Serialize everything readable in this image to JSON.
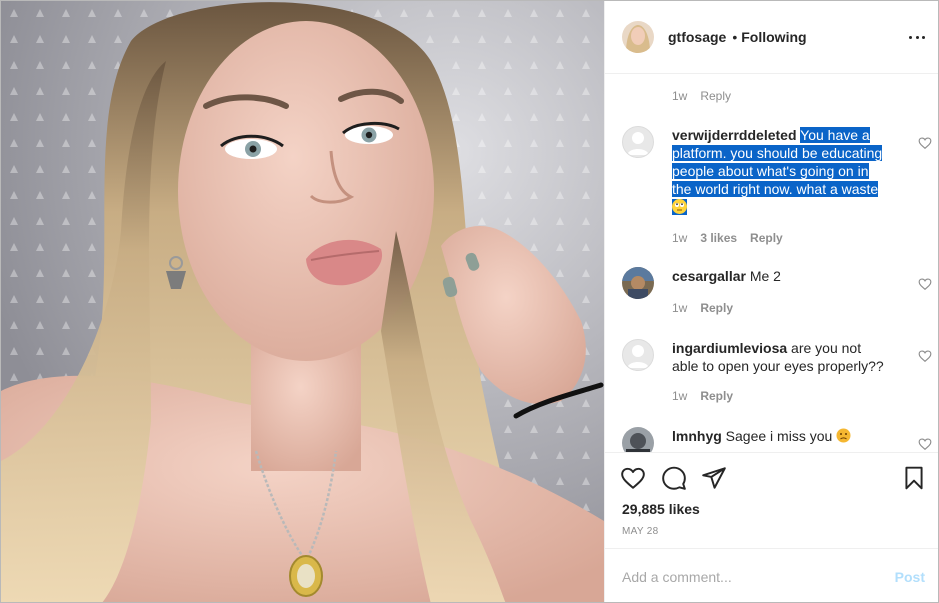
{
  "post": {
    "username": "gtfosage",
    "dot": "•",
    "follow_status": "Following",
    "likes": "29,885 likes",
    "date": "MAY 28"
  },
  "comments": [
    {
      "meta_time": "1w",
      "meta_reply": "Reply"
    },
    {
      "username": "verwijderrddeleted",
      "text": "You have a platform. you should be educating people about what's going on in the world right now. what a waste",
      "emoji": "rolling-eyes-emoji",
      "meta_time": "1w",
      "meta_likes": "3 likes",
      "meta_reply": "Reply"
    },
    {
      "username": "cesargallar",
      "text": "Me 2",
      "meta_time": "1w",
      "meta_reply": "Reply"
    },
    {
      "username": "ingardiumleviosa",
      "text": "are you not able to open your eyes properly??",
      "meta_time": "1w",
      "meta_reply": "Reply"
    },
    {
      "username": "lmnhyg",
      "text": "Sagee i miss you",
      "emoji": "sad-face-emoji"
    }
  ],
  "add_comment": {
    "placeholder": "Add a comment...",
    "post_label": "Post"
  },
  "icons": {
    "like": "heart-icon",
    "comment": "comment-bubble-icon",
    "share": "paper-plane-icon",
    "save": "bookmark-icon",
    "more": "more-options-icon"
  },
  "colors": {
    "highlight": "#0a64c8",
    "post_disabled": "#b2dffc",
    "muted": "#8e8e8e",
    "text": "#262626"
  }
}
